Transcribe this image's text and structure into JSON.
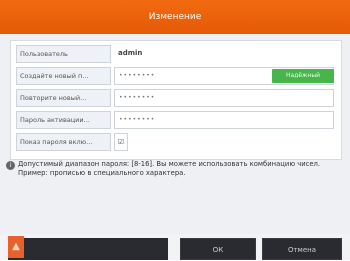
{
  "dialog": {
    "title": "Изменение"
  },
  "form": {
    "username_label": "Пользователь",
    "username_value": "admin",
    "new_password_label": "Создайте новый п...",
    "new_password_value": "••••••••",
    "strength_label": "Надёжный",
    "confirm_password_label": "Повторите новый...",
    "confirm_password_value": "••••••••",
    "security_question_label": "Пароль активации...",
    "security_question_value": "••••••••",
    "show_password_label": "Показ пароля вклю...",
    "show_password_checked": "☑"
  },
  "note": {
    "icon": "info-icon",
    "text": "Допустимый диапазон пароля: [8-16]. Вы можете использовать комбинацию чисел. Пример: прописью в специального характера."
  },
  "buttons": {
    "ok_label": "ОК",
    "cancel_label": "Отмена"
  },
  "status": {
    "icon": "warning-icon"
  },
  "colors": {
    "accent": "#f26a10",
    "strength": "#48b54a"
  }
}
